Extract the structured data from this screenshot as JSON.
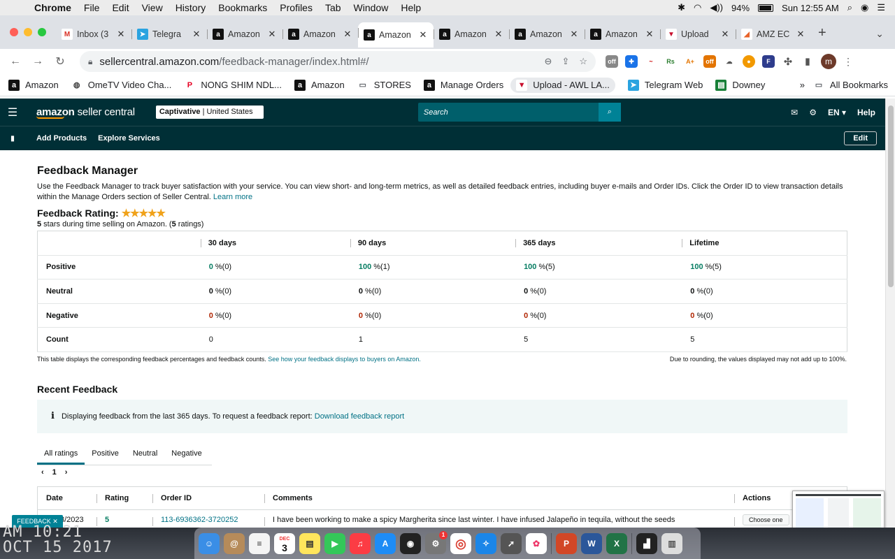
{
  "macbar": {
    "app": "Chrome",
    "menus": [
      "File",
      "Edit",
      "View",
      "History",
      "Bookmarks",
      "Profiles",
      "Tab",
      "Window",
      "Help"
    ],
    "battery": "94%",
    "time": "Sun 12:55 AM"
  },
  "tabs": [
    {
      "title": "Inbox (3",
      "icon": "gmail-icon",
      "active": false
    },
    {
      "title": "Telegra",
      "icon": "telegram-icon",
      "active": false
    },
    {
      "title": "Amazon",
      "icon": "amazon-icon",
      "active": false
    },
    {
      "title": "Amazon",
      "icon": "amazon-icon",
      "active": false
    },
    {
      "title": "Amazon",
      "icon": "amazon-icon",
      "active": true
    },
    {
      "title": "Amazon",
      "icon": "amazon-icon",
      "active": false
    },
    {
      "title": "Amazon",
      "icon": "amazon-icon",
      "active": false
    },
    {
      "title": "Amazon",
      "icon": "amazon-icon",
      "active": false
    },
    {
      "title": "Upload",
      "icon": "upload-icon",
      "active": false
    },
    {
      "title": "AMZ EC",
      "icon": "amz-ec-icon",
      "active": false
    }
  ],
  "url": {
    "host": "sellercentral.amazon.com",
    "path": "/feedback-manager/index.html#/"
  },
  "bookmarks": [
    {
      "label": "Amazon",
      "icon": "amazon-icon"
    },
    {
      "label": "OmeTV Video Cha...",
      "icon": "globe-icon"
    },
    {
      "label": "NONG SHIM NDL...",
      "icon": "pinterest-icon"
    },
    {
      "label": "Amazon",
      "icon": "amazon-icon"
    },
    {
      "label": "STORES",
      "icon": "folder-icon"
    },
    {
      "label": "Manage Orders",
      "icon": "amazon-icon"
    },
    {
      "label": "Upload - AWL LA...",
      "icon": "upload-icon"
    },
    {
      "label": "Telegram Web",
      "icon": "telegram-icon"
    },
    {
      "label": "Downey",
      "icon": "sheets-icon"
    }
  ],
  "bookmarks_more": "»",
  "all_bookmarks": "All Bookmarks",
  "sc": {
    "logo_a": "amazon",
    "logo_b": " seller central",
    "store_name": "Captivative",
    "store_region": " | United States",
    "search_placeholder": "Search",
    "lang": "EN",
    "help": "Help",
    "nav": [
      "Add Products",
      "Explore Services"
    ],
    "edit": "Edit"
  },
  "page": {
    "title": "Feedback Manager",
    "intro": "Use the Feedback Manager to track buyer satisfaction with your service. You can view short- and long-term metrics, as well as detailed feedback entries, including buyer e-mails and Order IDs. Click the Order ID to view transaction details within the Manage Orders section of Seller Central.",
    "learn_more": "Learn more",
    "rating_label": "Feedback Rating:",
    "stars": 5,
    "rating_sub_stars": "5",
    "rating_sub_text": " stars during time selling on Amazon. (",
    "rating_sub_count": "5",
    "rating_sub_end": " ratings)"
  },
  "feedback_table": {
    "columns": [
      "30 days",
      "90 days",
      "365 days",
      "Lifetime"
    ],
    "rows": [
      {
        "label": "Positive",
        "class": "green",
        "cells": [
          {
            "v": "0",
            "p": " %(0)"
          },
          {
            "v": "100",
            "p": " %(1)"
          },
          {
            "v": "100",
            "p": " %(5)"
          },
          {
            "v": "100",
            "p": " %(5)"
          }
        ]
      },
      {
        "label": "Neutral",
        "class": "neu",
        "cells": [
          {
            "v": "0",
            "p": " %(0)"
          },
          {
            "v": "0",
            "p": " %(0)"
          },
          {
            "v": "0",
            "p": " %(0)"
          },
          {
            "v": "0",
            "p": " %(0)"
          }
        ]
      },
      {
        "label": "Negative",
        "class": "red",
        "cells": [
          {
            "v": "0",
            "p": " %(0)"
          },
          {
            "v": "0",
            "p": " %(0)"
          },
          {
            "v": "0",
            "p": " %(0)"
          },
          {
            "v": "0",
            "p": " %(0)"
          }
        ]
      },
      {
        "label": "Count",
        "class": "",
        "cells": [
          {
            "v": "0",
            "p": ""
          },
          {
            "v": "1",
            "p": ""
          },
          {
            "v": "5",
            "p": ""
          },
          {
            "v": "5",
            "p": ""
          }
        ]
      }
    ],
    "note_left": "This table displays the corresponding feedback percentages and feedback counts.",
    "note_link": "See how your feedback displays to buyers on Amazon.",
    "note_right": "Due to rounding, the values displayed may not add up to 100%."
  },
  "recent": {
    "title": "Recent Feedback",
    "info": "Displaying feedback from the last 365 days. To request a feedback report:",
    "info_link": "Download feedback report",
    "filters": [
      "All ratings",
      "Positive",
      "Neutral",
      "Negative"
    ],
    "page": "1",
    "columns": [
      "Date",
      "Rating",
      "Order ID",
      "Comments",
      "Actions"
    ],
    "row": {
      "date": "8/2023",
      "rating": "5",
      "order_id": "113-6936362-3720252",
      "comment": "I have been working to make a spicy Margherita since last winter. I have infused Jalapeño in tequila, without the seeds",
      "action": "Choose one"
    }
  },
  "feedback_button": "FEEDBACK ✕",
  "desktop_clock": [
    "AM 10:21",
    "OCT 15 2017"
  ],
  "dock_calendar": {
    "month": "DEC",
    "day": "3"
  },
  "dock_badge": "1",
  "colors": {
    "sc_header": "#002f36",
    "link": "#007185",
    "positive": "#067d62",
    "negative": "#b12704",
    "star": "#f0a21a"
  }
}
